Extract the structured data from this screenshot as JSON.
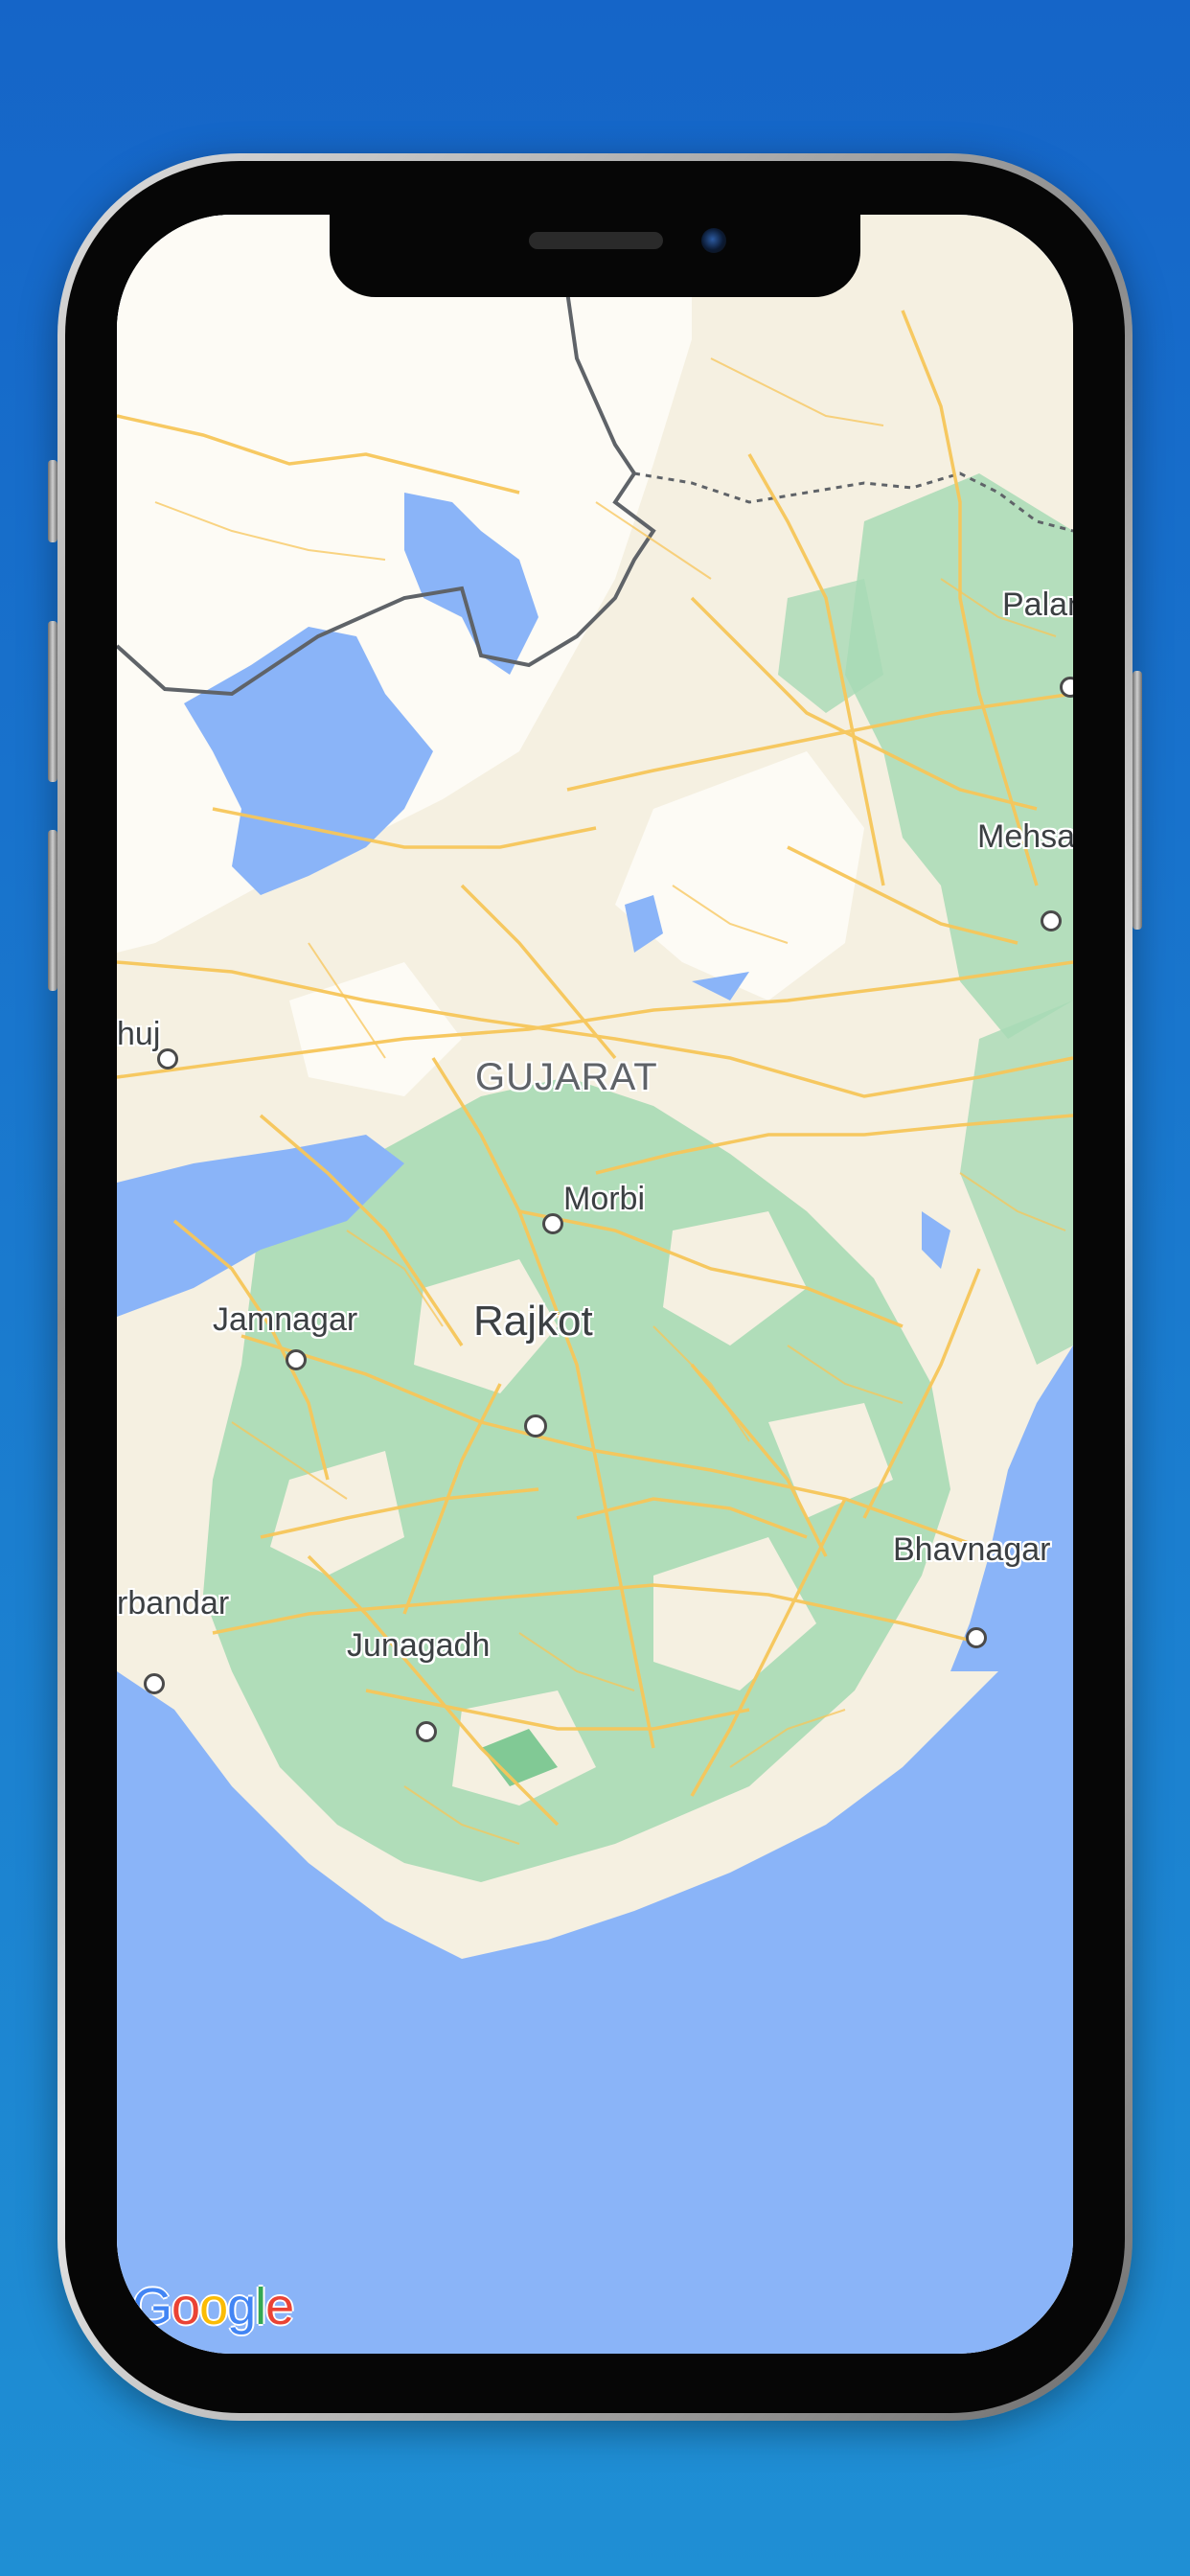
{
  "map": {
    "region_label": "GUJARAT",
    "cities": [
      {
        "name": "Palan",
        "size": "small"
      },
      {
        "name": "Mehsa",
        "size": "small"
      },
      {
        "name": "huj",
        "size": "small"
      },
      {
        "name": "Morbi",
        "size": "small"
      },
      {
        "name": "Jamnagar",
        "size": "small"
      },
      {
        "name": "Rajkot",
        "size": "large"
      },
      {
        "name": "Bhavnagar",
        "size": "small"
      },
      {
        "name": "rbandar",
        "size": "small"
      },
      {
        "name": "Junagadh",
        "size": "small"
      }
    ]
  },
  "attribution": {
    "logo_letters": [
      "G",
      "o",
      "o",
      "g",
      "l",
      "e"
    ],
    "colors": [
      "#4285f4",
      "#ea4335",
      "#fbbc05",
      "#4285f4",
      "#34a853",
      "#ea4335"
    ]
  },
  "colors": {
    "water": "#8ab4f8",
    "land": "#f5f0e1",
    "land_light": "#fdfbf5",
    "park": "#a8dab5",
    "road": "#f7c65a",
    "border": "#5f6368",
    "background_top": "#1565c8",
    "background_bottom": "#1f8fd4"
  }
}
